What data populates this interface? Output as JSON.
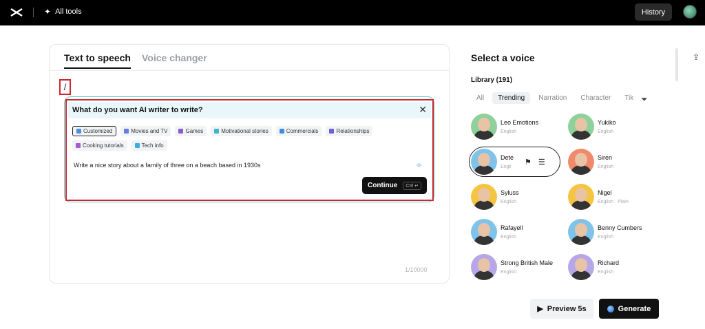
{
  "topbar": {
    "all_tools": "All tools",
    "history": "History"
  },
  "tabs": [
    {
      "label": "Text to speech",
      "active": true
    },
    {
      "label": "Voice changer",
      "active": false
    }
  ],
  "editor": {
    "slash": "/",
    "char_count": "1/10000"
  },
  "writer": {
    "title": "What do you want AI writer to write?",
    "close": "✕",
    "chips": [
      {
        "label": "Customized",
        "selected": true,
        "color": "#4a90e2"
      },
      {
        "label": "Movies and TV",
        "selected": false,
        "color": "#6b7be0"
      },
      {
        "label": "Games",
        "selected": false,
        "color": "#8a5cd1"
      },
      {
        "label": "Motivational stories",
        "selected": false,
        "color": "#3cb8c8"
      },
      {
        "label": "Commercials",
        "selected": false,
        "color": "#3c8fe0"
      },
      {
        "label": "Relationships",
        "selected": false,
        "color": "#6a63d6"
      },
      {
        "label": "Cooking tutorials",
        "selected": false,
        "color": "#a65cd1"
      },
      {
        "label": "Tech info",
        "selected": false,
        "color": "#3ab0e0"
      }
    ],
    "prompt": "Write a nice story about a family of three on a beach based in 1930s",
    "continue_label": "Continue",
    "shortcut": "Ctrl ↵"
  },
  "voice_panel": {
    "title": "Select a voice",
    "library": "Library (191)",
    "filters": [
      {
        "label": "All",
        "active": false
      },
      {
        "label": "Trending",
        "active": true
      },
      {
        "label": "Narration",
        "active": false
      },
      {
        "label": "Character",
        "active": false
      },
      {
        "label": "Tik",
        "active": false
      }
    ],
    "voices": [
      {
        "name": "Leo Emotions",
        "lang": "English",
        "bg": "#8ed19a",
        "hair": "#3a2a20"
      },
      {
        "name": "Yukiko",
        "lang": "English",
        "bg": "#8ed19a",
        "hair": "#1e1a18"
      },
      {
        "name": "Dete",
        "lang": "Engli",
        "bg": "#7fc3ea",
        "hair": "#1b1b2a",
        "selected": true
      },
      {
        "name": "Siren",
        "lang": "English",
        "bg": "#f08a6a",
        "hair": "#a0432a"
      },
      {
        "name": "Syluss",
        "lang": "English",
        "bg": "#f5c542",
        "hair": "#9a9a9a"
      },
      {
        "name": "Nigel",
        "lang": "English · Plain",
        "bg": "#f5c542",
        "hair": "#5a3a24"
      },
      {
        "name": "Rafayell",
        "lang": "English",
        "bg": "#7fc3ea",
        "hair": "#2a2a2a"
      },
      {
        "name": "Benny Cumbers",
        "lang": "English",
        "bg": "#7fc3ea",
        "hair": "#6a4a2a"
      },
      {
        "name": "Strong British Male",
        "lang": "English",
        "bg": "#b6a7e8",
        "hair": "#4a3322"
      },
      {
        "name": "Richard",
        "lang": "English",
        "bg": "#b6a7e8",
        "hair": "#6a4a30"
      }
    ]
  },
  "actions": {
    "preview": "Preview 5s",
    "generate": "Generate"
  }
}
